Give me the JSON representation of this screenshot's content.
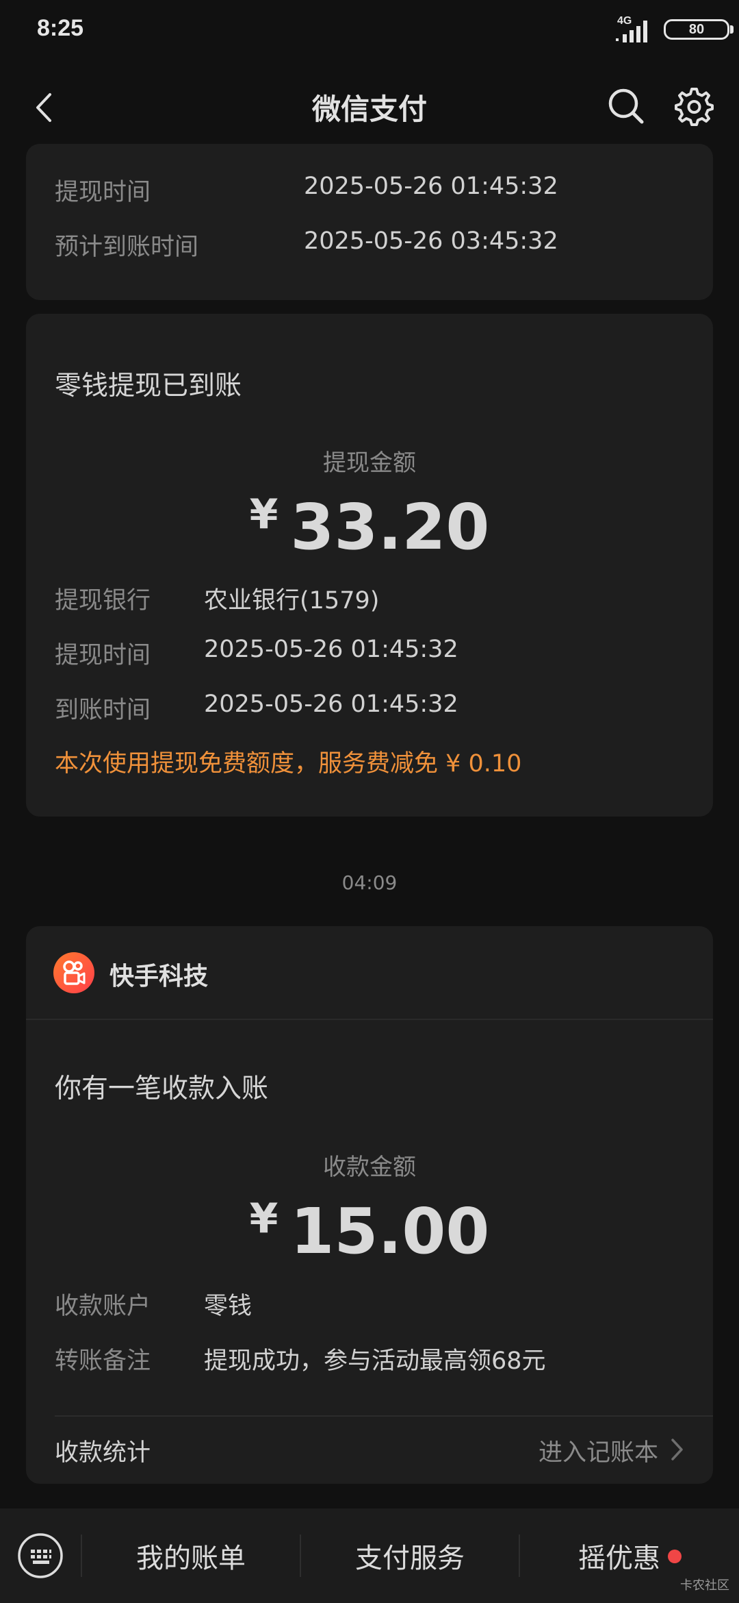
{
  "status_bar": {
    "time": "8:25",
    "network": "4G",
    "battery": "80"
  },
  "nav": {
    "title": "微信支付",
    "icons": [
      "back-icon",
      "search-icon",
      "gear-icon"
    ]
  },
  "top_card": {
    "rows": [
      {
        "label": "提现时间",
        "value": "2025-05-26 01:45:32"
      },
      {
        "label": "预计到账时间",
        "value": "2025-05-26 03:45:32"
      }
    ]
  },
  "withdraw_card": {
    "title": "零钱提现已到账",
    "amount_label": "提现金额",
    "currency": "¥",
    "amount": "33.20",
    "rows": [
      {
        "label": "提现银行",
        "value": "农业银行(1579)"
      },
      {
        "label": "提现时间",
        "value": "2025-05-26 01:45:32"
      },
      {
        "label": "到账时间",
        "value": "2025-05-26 01:45:32"
      }
    ],
    "notice": "本次使用提现免费额度，服务费减免 ¥ 0.10"
  },
  "timestamp": "04:09",
  "income_card": {
    "merchant": "快手科技",
    "title": "你有一笔收款入账",
    "amount_label": "收款金额",
    "currency": "¥",
    "amount": "15.00",
    "rows": [
      {
        "label": "收款账户",
        "value": "零钱"
      },
      {
        "label": "转账备注",
        "value": "提现成功，参与活动最高领68元"
      }
    ],
    "stats_label": "收款统计",
    "stats_link": "进入记账本"
  },
  "bottom_bar": {
    "tabs": [
      "我的账单",
      "支付服务",
      "摇优惠"
    ],
    "watermark": "卡农社区"
  },
  "colors": {
    "background": "#111111",
    "card": "#1e1e1e",
    "accent_orange": "#f0913a",
    "badge_red": "#f04646"
  }
}
